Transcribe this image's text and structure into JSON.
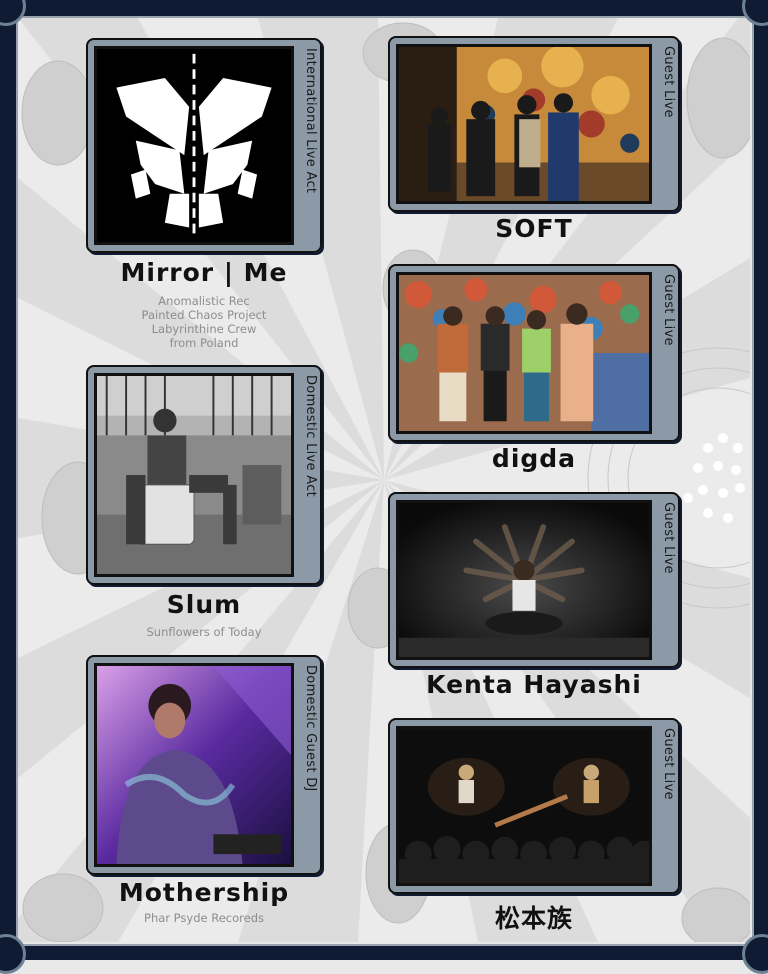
{
  "colors": {
    "frame": "#0f1b33",
    "plate": "#8b9aa6",
    "background": "#e9e9e9",
    "name_text": "#111111",
    "sub_text": "#8d8d8d"
  },
  "left_acts": [
    {
      "name": "Mirror | Me",
      "category": "International Live Act",
      "details": [
        "Anomalistic Rec",
        "Painted Chaos Project",
        "Labyrinthine Crew",
        "from Poland"
      ]
    },
    {
      "name": "Slum",
      "category": "Domestic Live Act",
      "details": [
        "Sunflowers of Today"
      ]
    },
    {
      "name": "Mothership",
      "category": "Domestic Guest DJ",
      "details": [
        "Phar Psyde Recoreds"
      ]
    }
  ],
  "right_acts": [
    {
      "name": "SOFT",
      "category": "Guest Live"
    },
    {
      "name": "digda",
      "category": "Guest Live"
    },
    {
      "name": "Kenta Hayashi",
      "category": "Guest Live"
    },
    {
      "name": "松本族",
      "category": "Guest Live"
    }
  ]
}
